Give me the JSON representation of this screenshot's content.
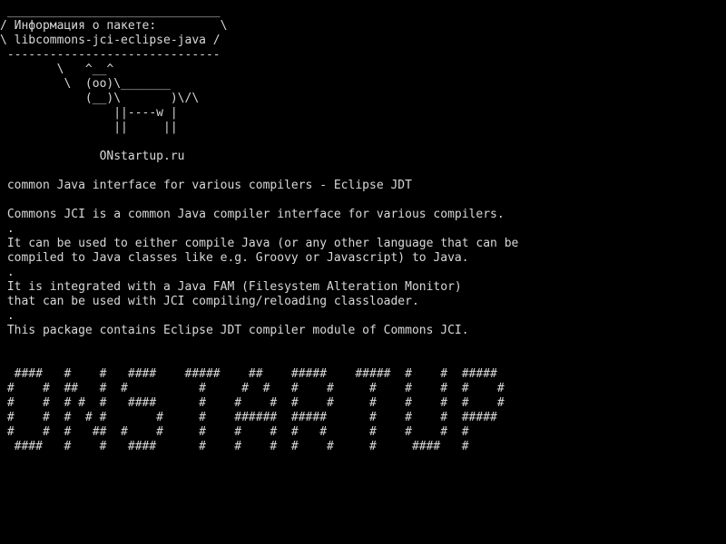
{
  "terminal": {
    "foreground": "#d8d8d8",
    "background": "#000000",
    "lines": [
      " ______________________________",
      "/ Информация о пакете:         \\",
      "\\ libcommons-jci-eclipse-java /",
      " ------------------------------",
      "        \\   ^__^",
      "         \\  (oo)\\_______",
      "            (__)\\       )\\/\\",
      "                ||----w |",
      "                ||     ||",
      "",
      "              ONstartup.ru",
      "",
      " common Java interface for various compilers - Eclipse JDT",
      "",
      " Commons JCI is a common Java compiler interface for various compilers.",
      " .",
      " It can be used to either compile Java (or any other language that can be",
      " compiled to Java classes like e.g. Groovy or Javascript) to Java.",
      " .",
      " It is integrated with a Java FAM (Filesystem Alteration Monitor)",
      " that can be used with JCI compiling/reloading classloader.",
      " .",
      " This package contains Eclipse JDT compiler module of Commons JCI.",
      "",
      "",
      "  ####   #    #   ####    #####    ##    #####    #####  #    #  #####",
      " #    #  ##   #  #          #     #  #   #    #     #    #    #  #    #",
      " #    #  # #  #   ####      #    #    #  #    #     #    #    #  #    #",
      " #    #  #  # #       #     #    ######  #####      #    #    #  #####",
      " #    #  #   ##  #    #     #    #    #  #   #      #    #    #  #",
      "  ####   #    #   ####      #    #    #  #    #     #     ####   #"
    ]
  }
}
